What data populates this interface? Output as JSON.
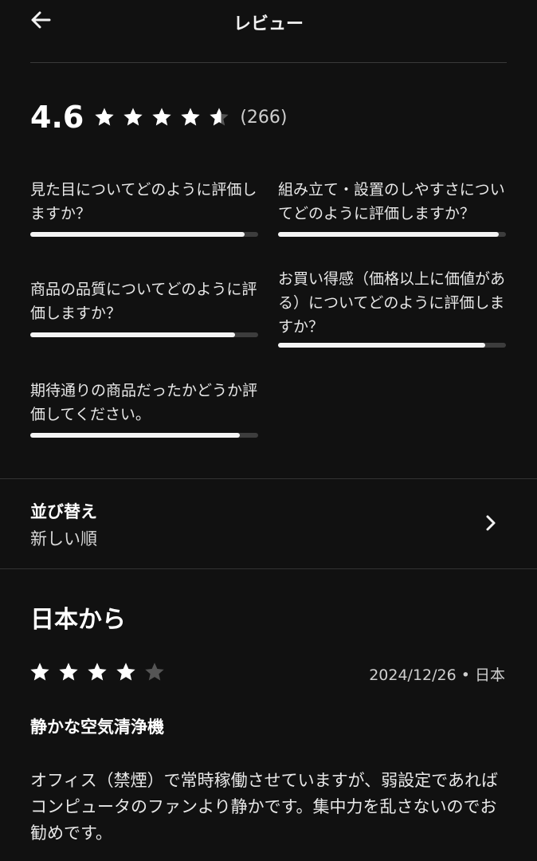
{
  "header": {
    "title": "レビュー",
    "back_icon": "arrow-left-icon"
  },
  "summary": {
    "rating": "4.6",
    "stars": 4.6,
    "count": "(266)"
  },
  "questions": [
    {
      "label": "見た目についてどのように評価しますか？",
      "score": 0.94
    },
    {
      "label": "組み立て・設置のしやすさについてどのように評価しますか？",
      "score": 0.97
    },
    {
      "label": "商品の品質についてどのように評価しますか？",
      "score": 0.9
    },
    {
      "label": "お買い得感（価格以上に価値がある）についてどのように評価しますか？",
      "score": 0.91
    },
    {
      "label": "期待通りの商品だったかどうか評価してください。",
      "score": 0.92
    }
  ],
  "sort": {
    "label": "並び替え",
    "value": "新しい順"
  },
  "section": {
    "title": "日本から"
  },
  "review": {
    "stars": 4,
    "date": "2024/12/26 • 日本",
    "title": "静かな空気清浄機",
    "body": "オフィス（禁煙）で常時稼働させていますが、弱設定であればコンピュータのファンより静かです。集中力を乱さないのでお勧めです。"
  },
  "colors": {
    "star_filled": "#ffffff",
    "star_empty": "#555555",
    "bar_fill": "#f4f4f4",
    "bar_track": "#3d3d3d"
  }
}
